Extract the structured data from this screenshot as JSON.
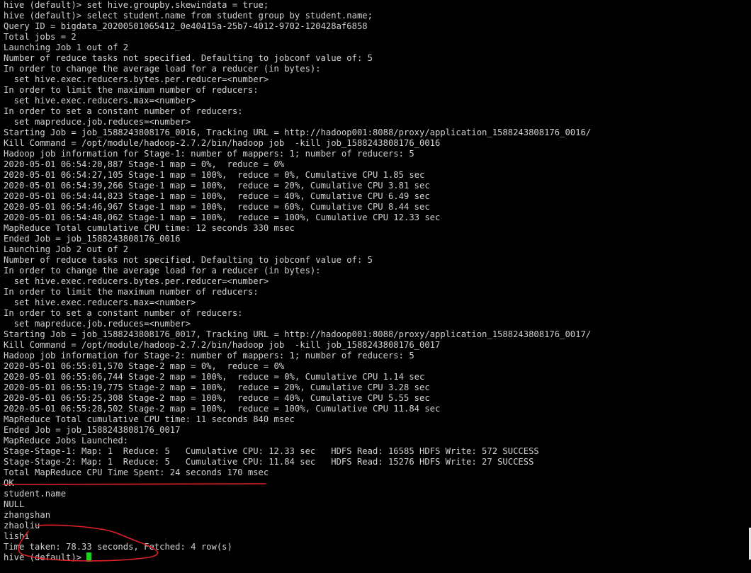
{
  "terminal": {
    "lines": [
      "hive (default)> set hive.groupby.skewindata = true;",
      "hive (default)> select student.name from student group by student.name;",
      "Query ID = bigdata_20200501065412_0e40415a-25b7-4012-9702-120428af6858",
      "Total jobs = 2",
      "Launching Job 1 out of 2",
      "Number of reduce tasks not specified. Defaulting to jobconf value of: 5",
      "In order to change the average load for a reducer (in bytes):",
      "  set hive.exec.reducers.bytes.per.reducer=<number>",
      "In order to limit the maximum number of reducers:",
      "  set hive.exec.reducers.max=<number>",
      "In order to set a constant number of reducers:",
      "  set mapreduce.job.reduces=<number>",
      "Starting Job = job_1588243808176_0016, Tracking URL = http://hadoop001:8088/proxy/application_1588243808176_0016/",
      "Kill Command = /opt/module/hadoop-2.7.2/bin/hadoop job  -kill job_1588243808176_0016",
      "Hadoop job information for Stage-1: number of mappers: 1; number of reducers: 5",
      "2020-05-01 06:54:20,887 Stage-1 map = 0%,  reduce = 0%",
      "2020-05-01 06:54:27,105 Stage-1 map = 100%,  reduce = 0%, Cumulative CPU 1.85 sec",
      "2020-05-01 06:54:39,266 Stage-1 map = 100%,  reduce = 20%, Cumulative CPU 3.81 sec",
      "2020-05-01 06:54:44,823 Stage-1 map = 100%,  reduce = 40%, Cumulative CPU 6.49 sec",
      "2020-05-01 06:54:46,967 Stage-1 map = 100%,  reduce = 60%, Cumulative CPU 8.44 sec",
      "2020-05-01 06:54:48,062 Stage-1 map = 100%,  reduce = 100%, Cumulative CPU 12.33 sec",
      "MapReduce Total cumulative CPU time: 12 seconds 330 msec",
      "Ended Job = job_1588243808176_0016",
      "Launching Job 2 out of 2",
      "Number of reduce tasks not specified. Defaulting to jobconf value of: 5",
      "In order to change the average load for a reducer (in bytes):",
      "  set hive.exec.reducers.bytes.per.reducer=<number>",
      "In order to limit the maximum number of reducers:",
      "  set hive.exec.reducers.max=<number>",
      "In order to set a constant number of reducers:",
      "  set mapreduce.job.reduces=<number>",
      "Starting Job = job_1588243808176_0017, Tracking URL = http://hadoop001:8088/proxy/application_1588243808176_0017/",
      "Kill Command = /opt/module/hadoop-2.7.2/bin/hadoop job  -kill job_1588243808176_0017",
      "Hadoop job information for Stage-2: number of mappers: 1; number of reducers: 5",
      "2020-05-01 06:55:01,570 Stage-2 map = 0%,  reduce = 0%",
      "2020-05-01 06:55:06,744 Stage-2 map = 100%,  reduce = 0%, Cumulative CPU 1.14 sec",
      "2020-05-01 06:55:19,775 Stage-2 map = 100%,  reduce = 20%, Cumulative CPU 3.28 sec",
      "2020-05-01 06:55:25,308 Stage-2 map = 100%,  reduce = 40%, Cumulative CPU 5.55 sec",
      "2020-05-01 06:55:28,502 Stage-2 map = 100%,  reduce = 100%, Cumulative CPU 11.84 sec",
      "MapReduce Total cumulative CPU time: 11 seconds 840 msec",
      "Ended Job = job_1588243808176_0017",
      "MapReduce Jobs Launched:",
      "Stage-Stage-1: Map: 1  Reduce: 5   Cumulative CPU: 12.33 sec   HDFS Read: 16585 HDFS Write: 572 SUCCESS",
      "Stage-Stage-2: Map: 1  Reduce: 5   Cumulative CPU: 11.84 sec   HDFS Read: 15276 HDFS Write: 27 SUCCESS",
      "Total MapReduce CPU Time Spent: 24 seconds 170 msec",
      "OK",
      "student.name",
      "NULL",
      "zhangshan",
      "zhaoliu",
      "lishi",
      "Time taken: 78.33 seconds, Fetched: 4 row(s)"
    ],
    "prompt": "hive (default)> "
  },
  "colors": {
    "background": "#000000",
    "text": "#d2d2d2",
    "cursor": "#22d022",
    "annotation": "#e0202a"
  }
}
